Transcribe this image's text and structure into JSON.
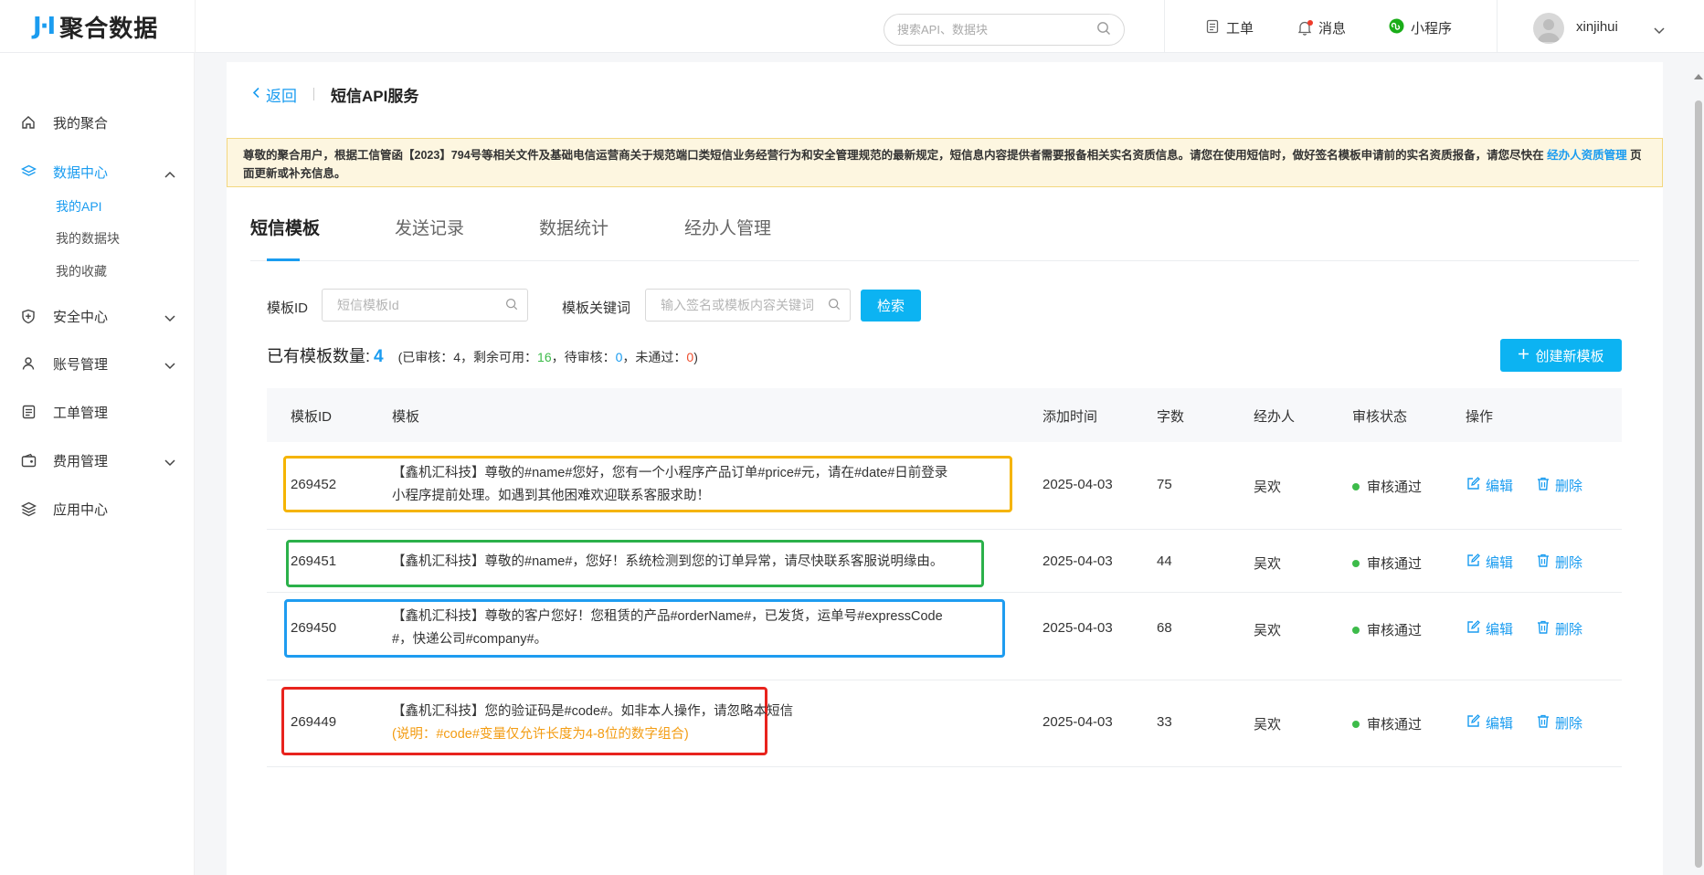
{
  "app": {
    "logo_mark": "J·I",
    "logo_text": "聚合数据"
  },
  "header": {
    "search_placeholder": "搜索API、数据块",
    "ticket_label": "工单",
    "message_label": "消息",
    "miniapp_label": "小程序",
    "username": "xinjihui"
  },
  "sidebar": {
    "my_juhe": "我的聚合",
    "data_center": "数据中心",
    "my_api": "我的API",
    "my_blocks": "我的数据块",
    "my_favorites": "我的收藏",
    "security_center": "安全中心",
    "account_mgmt": "账号管理",
    "ticket_mgmt": "工单管理",
    "fee_mgmt": "费用管理",
    "app_center": "应用中心"
  },
  "page": {
    "back_label": "返回",
    "title": "短信API服务"
  },
  "notice": {
    "text_before": "尊敬的聚合用户，根据工信管函【2023】794号等相关文件及基础电信运营商关于规范端口类短信业务经营行为和安全管理规范的最新规定，短信息内容提供者需要报备相关实名资质信息。请您在使用短信时，做好签名模板申请前的实名资质报备，请您尽快在 ",
    "link_text": "经办人资质管理",
    "text_after": " 页面更新或补充信息。"
  },
  "tabs": [
    "短信模板",
    "发送记录",
    "数据统计",
    "经办人管理"
  ],
  "filters": {
    "id_label": "模板ID",
    "id_placeholder": "短信模板Id",
    "keyword_label": "模板关键词",
    "keyword_placeholder": "输入签名或模板内容关键词",
    "search_button": "检索"
  },
  "summary": {
    "label": "已有模板数量:",
    "total": "4",
    "approved_prefix": "(已审核：4，剩余可用：",
    "remaining": "16",
    "pending_prefix": "，待审核：",
    "pending": "0",
    "rejected_prefix": "，未通过：",
    "rejected": "0",
    "suffix": ")"
  },
  "create_button": "创建新模板",
  "table": {
    "columns": [
      "模板ID",
      "模板",
      "添加时间",
      "字数",
      "经办人",
      "审核状态",
      "操作"
    ],
    "edit_label": "编辑",
    "delete_label": "删除",
    "rows": [
      {
        "id": "269452",
        "template_line1": "【鑫机汇科技】尊敬的#name#您好，您有一个小程序产品订单#price#元，请在#date#日前登录",
        "template_line2": "小程序提前处理。如遇到其他困难欢迎联系客服求助！",
        "date": "2025-04-03",
        "chars": "75",
        "handler": "吴欢",
        "status": "审核通过",
        "highlight": "#f5b400"
      },
      {
        "id": "269451",
        "template_line1": "【鑫机汇科技】尊敬的#name#，您好！系统检测到您的订单异常，请尽快联系客服说明缘由。",
        "template_line2": "",
        "date": "2025-04-03",
        "chars": "44",
        "handler": "吴欢",
        "status": "审核通过",
        "highlight": "#2bb14a"
      },
      {
        "id": "269450",
        "template_line1": "【鑫机汇科技】尊敬的客户您好！您租赁的产品#orderName#，已发货，运单号#expressCode",
        "template_line2": "#，快递公司#company#。",
        "date": "2025-04-03",
        "chars": "68",
        "handler": "吴欢",
        "status": "审核通过",
        "highlight": "#1e9cf0"
      },
      {
        "id": "269449",
        "template_line1": "【鑫机汇科技】您的验证码是#code#。如非本人操作，请忽略本短信",
        "template_line2": "(说明：#code#变量仅允许长度为4-8位的数字组合)",
        "date": "2025-04-03",
        "chars": "33",
        "handler": "吴欢",
        "status": "审核通过",
        "highlight": "#e8231d"
      }
    ]
  }
}
